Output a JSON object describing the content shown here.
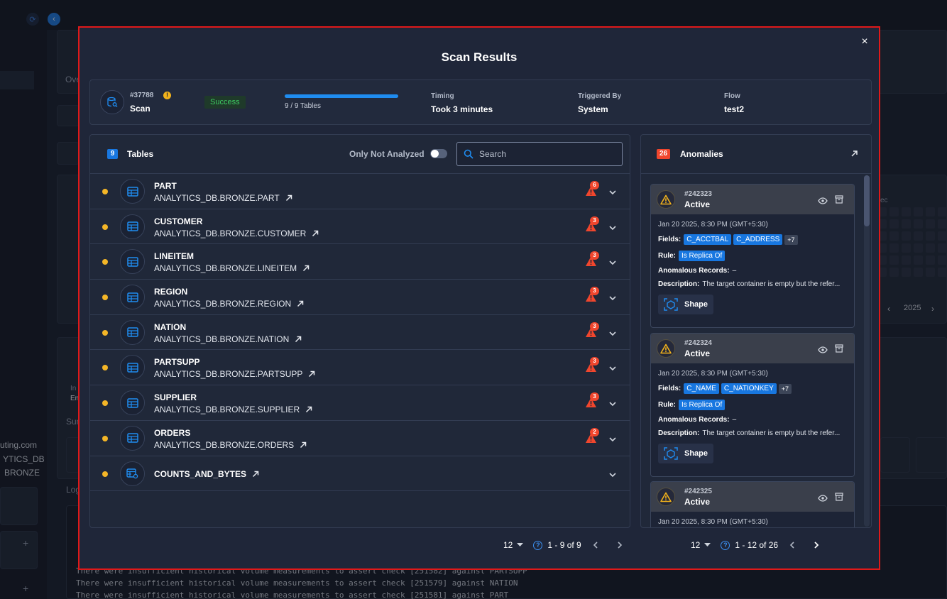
{
  "background": {
    "sidebar_lines": [
      "uting.com",
      "YTICS_DB",
      "BRONZE"
    ],
    "tab_fragment": "Ove",
    "card_labels": [
      "In",
      "En"
    ],
    "section_labels": [
      "Sum",
      "Log"
    ],
    "heatmap_label": "ec",
    "year": "2025",
    "log_lines": [
      "There were insufficient historical volume measurements to assert check [251582] against PARTSUPP",
      "There were insufficient historical volume measurements to assert check [251579] against NATION",
      "There were insufficient historical volume measurements to assert check [251581] against PART"
    ]
  },
  "modal": {
    "title": "Scan Results",
    "close_label": "×",
    "summary": {
      "id": "#37788",
      "warn_glyph": "!",
      "type": "Scan",
      "status": "Success",
      "status_color": "#3ecb62",
      "progress_fraction": 1.0,
      "progress_label": "9 / 9 Tables",
      "timing_label": "Timing",
      "timing_value": "Took 3 minutes",
      "triggered_label": "Triggered By",
      "triggered_value": "System",
      "flow_label": "Flow",
      "flow_value": "test2"
    },
    "tables": {
      "count": "9",
      "title": "Tables",
      "only_not_analyzed_label": "Only Not Analyzed",
      "only_not_analyzed_on": false,
      "search_placeholder": "Search",
      "rows": [
        {
          "name": "PART",
          "path": "ANALYTICS_DB.BRONZE.PART",
          "anomalies": "6"
        },
        {
          "name": "CUSTOMER",
          "path": "ANALYTICS_DB.BRONZE.CUSTOMER",
          "anomalies": "3"
        },
        {
          "name": "LINEITEM",
          "path": "ANALYTICS_DB.BRONZE.LINEITEM",
          "anomalies": "3"
        },
        {
          "name": "REGION",
          "path": "ANALYTICS_DB.BRONZE.REGION",
          "anomalies": "3"
        },
        {
          "name": "NATION",
          "path": "ANALYTICS_DB.BRONZE.NATION",
          "anomalies": "3"
        },
        {
          "name": "PARTSUPP",
          "path": "ANALYTICS_DB.BRONZE.PARTSUPP",
          "anomalies": "3"
        },
        {
          "name": "SUPPLIER",
          "path": "ANALYTICS_DB.BRONZE.SUPPLIER",
          "anomalies": "3"
        },
        {
          "name": "ORDERS",
          "path": "ANALYTICS_DB.BRONZE.ORDERS",
          "anomalies": "2"
        }
      ],
      "computed_row": {
        "name": "COUNTS_AND_BYTES"
      },
      "pager": {
        "page_size": "12",
        "help": "?",
        "range": "1 - 9 of 9"
      }
    },
    "anomalies": {
      "count": "26",
      "title": "Anomalies",
      "cards": [
        {
          "id": "#242323",
          "status": "Active",
          "date": "Jan 20 2025, 8:30 PM (GMT+5:30)",
          "fields_label": "Fields:",
          "fields": [
            "C_ACCTBAL",
            "C_ADDRESS"
          ],
          "more": "+7",
          "rule_label": "Rule:",
          "rule": "Is Replica Of",
          "records_label": "Anomalous Records:",
          "records": "–",
          "desc_label": "Description:",
          "desc": "The target container is empty but the refer...",
          "type": "Shape"
        },
        {
          "id": "#242324",
          "status": "Active",
          "date": "Jan 20 2025, 8:30 PM (GMT+5:30)",
          "fields_label": "Fields:",
          "fields": [
            "C_NAME",
            "C_NATIONKEY"
          ],
          "more": "+7",
          "rule_label": "Rule:",
          "rule": "Is Replica Of",
          "records_label": "Anomalous Records:",
          "records": "–",
          "desc_label": "Description:",
          "desc": "The target container is empty but the refer...",
          "type": "Shape"
        },
        {
          "id": "#242325",
          "status": "Active",
          "date": "Jan 20 2025, 8:30 PM (GMT+5:30)"
        }
      ],
      "pager": {
        "page_size": "12",
        "help": "?",
        "range": "1 - 12 of 26"
      }
    }
  },
  "colors": {
    "accent": "#1f8cf0",
    "anomaly": "#f0462d",
    "modal_border": "#e01919",
    "pending_dot": "#f4b627"
  }
}
